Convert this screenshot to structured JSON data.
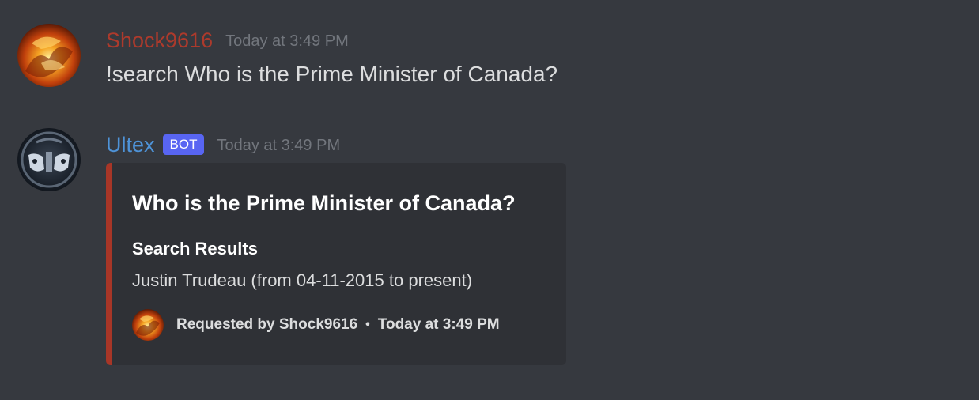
{
  "messages": [
    {
      "author": "Shock9616",
      "timestamp": "Today at 3:49 PM",
      "content": "!search Who is the Prime Minister of Canada?",
      "avatar_icon": "flame-avatar-icon"
    },
    {
      "author": "Ultex",
      "badge": "BOT",
      "timestamp": "Today at 3:49 PM",
      "avatar_icon": "robot-avatar-icon",
      "embed": {
        "title": "Who is the Prime Minister of Canada?",
        "field_name": "Search Results",
        "field_value": "Justin Trudeau (from 04-11-2015 to present)",
        "footer_text": "Requested by Shock9616",
        "footer_separator": "•",
        "footer_timestamp": "Today at 3:49 PM",
        "accent_color": "#a83627"
      }
    }
  ],
  "colors": {
    "background": "#36393f",
    "embed_background": "#2f3136",
    "user_name": "#ad3a2c",
    "bot_name": "#4e93d8",
    "bot_badge": "#5865f2",
    "timestamp": "#72767d"
  }
}
